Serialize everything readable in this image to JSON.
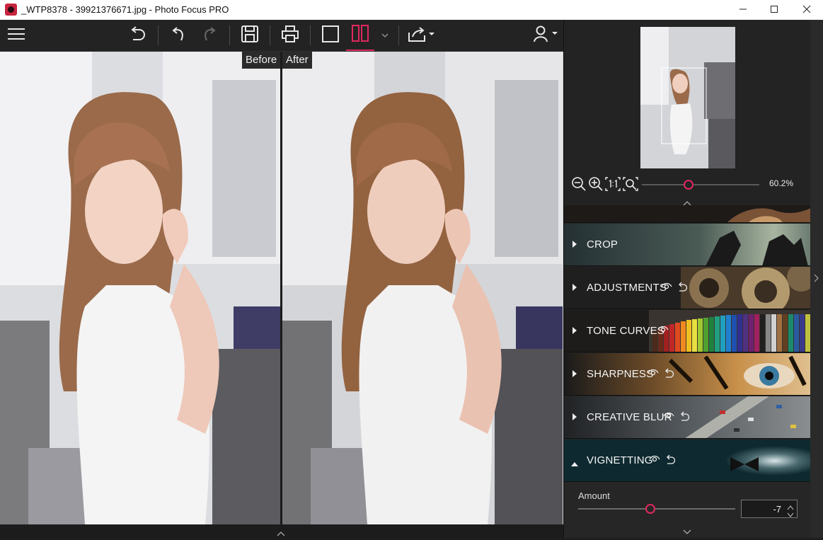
{
  "window": {
    "title": "_WTP8378 - 39921376671.jpg - Photo Focus PRO",
    "minimize_icon": "minimize-icon",
    "maximize_icon": "maximize-icon",
    "close_icon": "close-icon"
  },
  "toolbar": {
    "icons": [
      "menu-icon",
      "undo-all-icon",
      "undo-icon",
      "redo-icon",
      "save-icon",
      "print-icon",
      "single-view-icon",
      "split-view-icon",
      "dropdown-icon",
      "share-icon",
      "user-icon"
    ],
    "accent_color": "#e0285f"
  },
  "compare": {
    "before_label": "Before",
    "after_label": "After"
  },
  "navigator": {
    "zoom_value": "60.2%",
    "zoom_slider_level": 0.4,
    "zoom_icons": [
      "zoom-out-icon",
      "zoom-in-icon",
      "actual-size-icon",
      "fit-icon"
    ]
  },
  "panels": [
    {
      "id": "crop",
      "label": "CROP",
      "expanded": false,
      "icons": []
    },
    {
      "id": "adjustments",
      "label": "ADJUSTMENTS",
      "expanded": false,
      "icons": [
        "eye-icon",
        "reset-icon"
      ]
    },
    {
      "id": "tone-curves",
      "label": "TONE CURVES",
      "expanded": false,
      "icons": [
        "eye-icon"
      ]
    },
    {
      "id": "sharpness",
      "label": "SHARPNESS",
      "expanded": false,
      "icons": [
        "eye-icon",
        "reset-icon"
      ]
    },
    {
      "id": "creative-blur",
      "label": "CREATIVE BLUR",
      "expanded": false,
      "icons": [
        "eye-icon",
        "reset-icon"
      ]
    },
    {
      "id": "vignetting",
      "label": "VIGNETTING",
      "expanded": true,
      "icons": [
        "eye-icon",
        "reset-icon"
      ]
    }
  ],
  "vignetting": {
    "amount_label": "Amount",
    "amount_value": "-7",
    "amount_slider_level": 0.46
  }
}
